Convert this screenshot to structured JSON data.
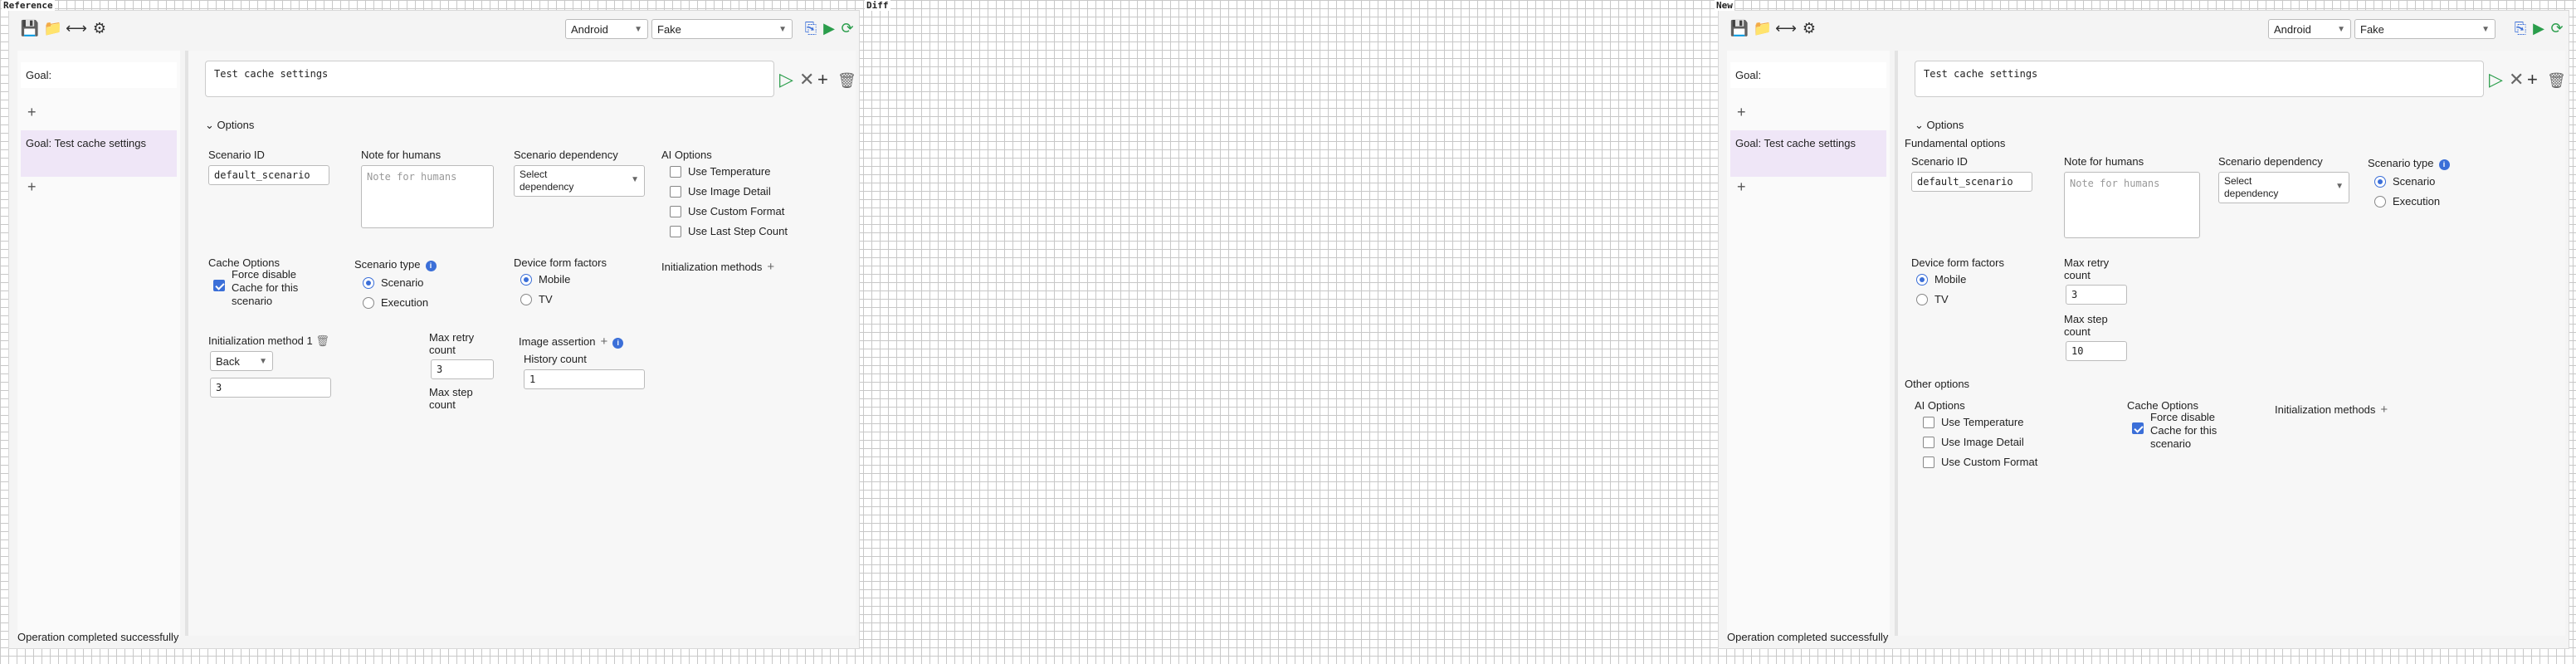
{
  "panels": {
    "reference": "Reference",
    "diff": "Diff",
    "new": "New"
  },
  "toolbar": {
    "icons": [
      "save-icon",
      "folder-icon",
      "share-icon",
      "gear-icon"
    ],
    "platform": "Android",
    "device": "Fake",
    "right_icons": [
      "device-add-icon",
      "play-next-icon",
      "refresh-icon"
    ]
  },
  "sidebar": {
    "goal_empty": "Goal:",
    "goal_selected": "Goal: Test cache settings"
  },
  "goal": {
    "text": "Test cache settings"
  },
  "options": {
    "toggle": "Options",
    "fundamental": "Fundamental options",
    "other": "Other options",
    "scenario_id_label": "Scenario ID",
    "scenario_id_value": "default_scenario",
    "note_label": "Note for humans",
    "note_placeholder": "Note for humans",
    "dependency_label": "Scenario dependency",
    "dependency_value_1": "Select",
    "dependency_value_2": "dependency",
    "ai_options_label": "AI Options",
    "ai_options": [
      "Use Temperature",
      "Use Image Detail",
      "Use Custom Format",
      "Use Last Step Count"
    ],
    "cache_label": "Cache Options",
    "cache_force": "Force disable Cache for this scenario",
    "scenario_type_label": "Scenario type",
    "scenario_types": [
      "Scenario",
      "Execution"
    ],
    "device_form_label": "Device form factors",
    "device_forms": [
      "Mobile",
      "TV"
    ],
    "init_methods_label": "Initialization methods",
    "init_method_1_label": "Initialization method 1",
    "init_method_1_action": "Back",
    "init_method_1_value": "3",
    "max_retry_label": "Max retry count",
    "max_retry_value": "3",
    "max_step_label": "Max step count",
    "max_step_value": "10",
    "image_assertion_label": "Image assertion",
    "history_count_label": "History count",
    "history_count_value": "1"
  },
  "status": "Operation completed successfully",
  "colors": {
    "accent": "#3b6fd8",
    "diff": "#ff0000",
    "selected": "#efe6f7"
  }
}
